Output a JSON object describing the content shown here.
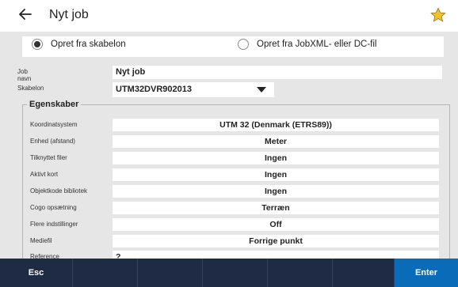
{
  "header": {
    "title": "Nyt job",
    "back_icon": "arrow-left-icon",
    "star_icon": "star-icon",
    "star_color": "#f2c12e"
  },
  "source": {
    "options": [
      {
        "label": "Opret fra skabelon",
        "selected": true
      },
      {
        "label": "Opret fra JobXML- eller DC-fil",
        "selected": false
      }
    ]
  },
  "job": {
    "name_label": "Job navn",
    "name_value": "Nyt job",
    "template_label": "Skabelon",
    "template_value": "UTM32DVR902013"
  },
  "properties": {
    "legend": "Egenskaber",
    "rows": [
      {
        "label": "Koordinatsystem",
        "value": "UTM 32 (Denmark (ETRS89))"
      },
      {
        "label": "Enhed (afstand)",
        "value": "Meter"
      },
      {
        "label": "Tilknyttet filer",
        "value": "Ingen"
      },
      {
        "label": "Aktivt kort",
        "value": "Ingen"
      },
      {
        "label": "Objektkode bibliotek",
        "value": "Ingen"
      },
      {
        "label": "Cogo opsætning",
        "value": "Terræn"
      },
      {
        "label": "Flere indstillinger",
        "value": "Off"
      },
      {
        "label": "Mediefil",
        "value": "Forrige punkt"
      },
      {
        "label": "Reference",
        "value": "?"
      }
    ]
  },
  "footer": {
    "esc_label": "Esc",
    "enter_label": "Enter",
    "colors": {
      "bar": "#1f2a44",
      "enter": "#0a6bb8"
    }
  }
}
